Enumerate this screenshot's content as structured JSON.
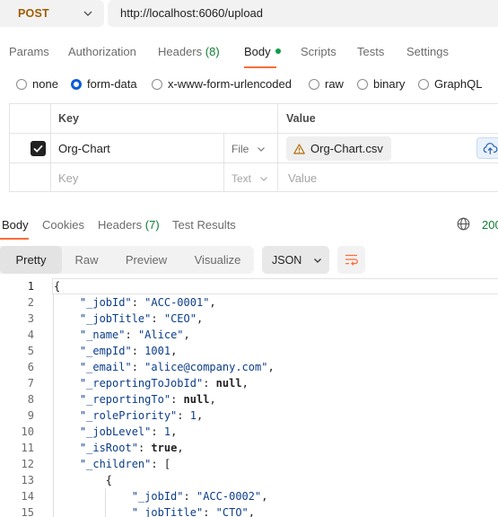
{
  "request": {
    "method": "POST",
    "url": "http://localhost:6060/upload"
  },
  "request_tabs": [
    {
      "label": "Params"
    },
    {
      "label": "Authorization"
    },
    {
      "label": "Headers",
      "count": "(8)"
    },
    {
      "label": "Body"
    },
    {
      "label": "Scripts"
    },
    {
      "label": "Tests"
    },
    {
      "label": "Settings"
    }
  ],
  "body_types": [
    "none",
    "form-data",
    "x-www-form-urlencoded",
    "raw",
    "binary",
    "GraphQL"
  ],
  "body_type_selected": "form-data",
  "form_data": {
    "headers": {
      "key": "Key",
      "value": "Value"
    },
    "rows": [
      {
        "checked": true,
        "key": "Org-Chart",
        "type": "File",
        "value": "Org-Chart.csv",
        "warning_icon": "warning-triangle-icon"
      },
      {
        "checked": false,
        "key_placeholder": "Key",
        "type": "Text",
        "value_placeholder": "Value"
      }
    ]
  },
  "response_tabs": [
    {
      "label": "Body"
    },
    {
      "label": "Cookies"
    },
    {
      "label": "Headers",
      "count": "(7)"
    },
    {
      "label": "Test Results"
    }
  ],
  "response_status": "200",
  "view_modes": [
    "Pretty",
    "Raw",
    "Preview",
    "Visualize"
  ],
  "view_mode_selected": "Pretty",
  "format": "JSON",
  "code_lines": [
    {
      "n": "1",
      "text": "{"
    },
    {
      "n": "2",
      "text": "    \"_jobId\": \"ACC-0001\","
    },
    {
      "n": "3",
      "text": "    \"_jobTitle\": \"CEO\","
    },
    {
      "n": "4",
      "text": "    \"_name\": \"Alice\","
    },
    {
      "n": "5",
      "text": "    \"_empId\": 1001,"
    },
    {
      "n": "6",
      "text": "    \"_email\": \"alice@company.com\","
    },
    {
      "n": "7",
      "text": "    \"_reportingToJobId\": null,"
    },
    {
      "n": "8",
      "text": "    \"_reportingTo\": null,"
    },
    {
      "n": "9",
      "text": "    \"_rolePriority\": 1,"
    },
    {
      "n": "10",
      "text": "    \"_jobLevel\": 1,"
    },
    {
      "n": "11",
      "text": "    \"_isRoot\": true,"
    },
    {
      "n": "12",
      "text": "    \"_children\": ["
    },
    {
      "n": "13",
      "text": "        {"
    },
    {
      "n": "14",
      "text": "            \"_jobId\": \"ACC-0002\","
    },
    {
      "n": "15",
      "text": "            \"_jobTitle\": \"CTO\","
    }
  ],
  "colors": {
    "accent": "#ff6c37",
    "method": "#a15c00",
    "count_green": "#0c7d35",
    "json_blue": "#0b3d8c"
  }
}
